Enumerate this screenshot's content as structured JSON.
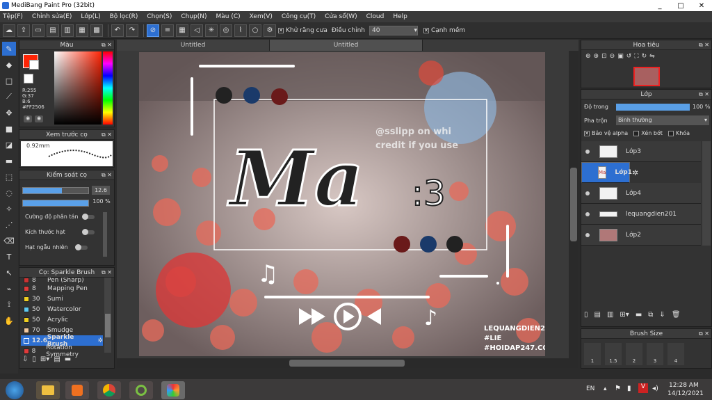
{
  "window": {
    "title": "MediBang Paint Pro (32bit)",
    "min": "_",
    "max": "□",
    "close": "✕"
  },
  "menu": [
    "Tệp(F)",
    "Chỉnh sửa(E)",
    "Lớp(L)",
    "Bộ lọc(R)",
    "Chọn(S)",
    "Chụp(N)",
    "Màu (C)",
    "Xem(V)",
    "Công cụ(T)",
    "Cửa sổ(W)",
    "Cloud",
    "Help"
  ],
  "toolbar": {
    "antialias_label": "Khử răng cưa",
    "correction_label": "Điều chỉnh",
    "correction_value": "40",
    "edge_label": "Cạnh mềm"
  },
  "color_panel": {
    "title": "Màu",
    "r": "R:255",
    "g": "G:37",
    "b": "B:6",
    "hex": "#FF2506",
    "fg_color": "#ff2506"
  },
  "preview_panel": {
    "title": "Xem trước cọ",
    "size": "0.92mm"
  },
  "brush_control": {
    "title": "Kiểm soát cọ",
    "size_value": "12.6",
    "opacity_value": "100 %",
    "size_fill": 0.6,
    "opacity_fill": 1.0,
    "scatter_label": "Cường độ phân tán",
    "grain_label": "Kích thước hạt",
    "random_label": "Hạt ngẫu nhiên"
  },
  "brush_list": {
    "title": "Cọ: Sparkle Brush",
    "items": [
      {
        "size": "8",
        "name": "Pen (Sharp)",
        "color": "#cc3333"
      },
      {
        "size": "8",
        "name": "Mapping Pen",
        "color": "#e03a3a"
      },
      {
        "size": "30",
        "name": "Sumi",
        "color": "#f0d020"
      },
      {
        "size": "50",
        "name": "Watercolor",
        "color": "#5ec8f0"
      },
      {
        "size": "50",
        "name": "Acrylic",
        "color": "#f0d020"
      },
      {
        "size": "70",
        "name": "Smudge",
        "color": "#f3c89e"
      },
      {
        "size": "12.6",
        "name": "Sparkle Brush",
        "color": "#2d6fd1"
      },
      {
        "size": "8",
        "name": "Rotation Symmetry",
        "color": "#e03a3a"
      }
    ]
  },
  "tabs": [
    "Untitled",
    "Untitled"
  ],
  "navigator": {
    "title": "Hoa tiêu"
  },
  "layer_panel": {
    "title": "Lớp",
    "opacity_label": "Độ trong",
    "opacity_value": "100 %",
    "blend_label": "Pha trộn",
    "blend_value": "Bình thường",
    "protect_alpha": "Bảo vệ alpha",
    "clip": "Xén bớt",
    "lock": "Khóa"
  },
  "layers": [
    {
      "name": "Lớp3",
      "selected": false
    },
    {
      "name": "Lớp1",
      "selected": true
    },
    {
      "name": "Lớp4",
      "selected": false
    },
    {
      "name": "lequangdien201",
      "selected": false
    },
    {
      "name": "Lớp2",
      "selected": false
    }
  ],
  "brush_size": {
    "title": "Brush Size",
    "sizes": [
      "1",
      "1.5",
      "2",
      "3",
      "4"
    ]
  },
  "artwork": {
    "watermark1": "@sslipp on whi",
    "watermark2": "credit if you use",
    "main_text": "Ma",
    "sub_text": ":3",
    "credit1": "LEQUANGDIEN201",
    "credit2": "#LIE",
    "credit3": "#HOIDAP247.COM"
  },
  "taskbar": {
    "lang": "EN",
    "time": "12:28 AM",
    "date": "14/12/2021"
  }
}
